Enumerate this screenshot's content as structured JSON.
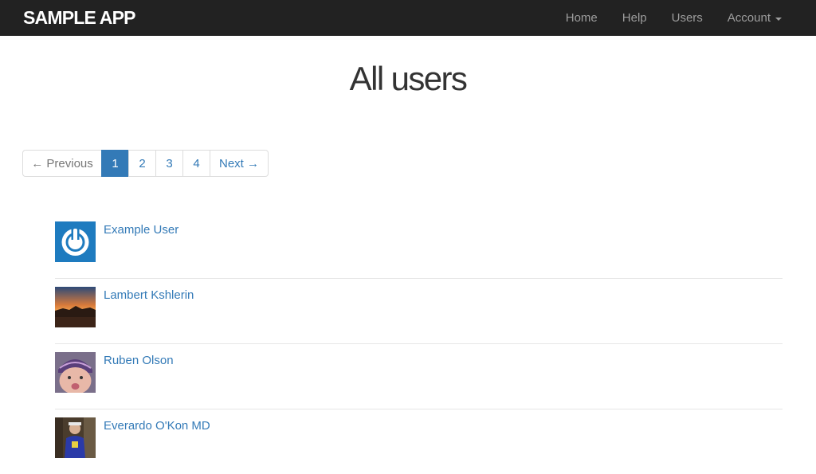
{
  "navbar": {
    "brand": "SAMPLE APP",
    "links": [
      "Home",
      "Help",
      "Users"
    ],
    "account_label": "Account",
    "account_icon": "caret-down-icon"
  },
  "page": {
    "title": "All users"
  },
  "pagination": {
    "previous_label": "← Previous",
    "pages": [
      "1",
      "2",
      "3",
      "4"
    ],
    "active_page": "1",
    "next_label": "Next →"
  },
  "users": [
    {
      "name": "Example User",
      "avatar": "power-icon-avatar"
    },
    {
      "name": "Lambert Kshlerin",
      "avatar": "sunset-photo-avatar"
    },
    {
      "name": "Ruben Olson",
      "avatar": "child-photo-avatar"
    },
    {
      "name": "Everardo O'Kon MD",
      "avatar": "person-photo-avatar"
    }
  ],
  "colors": {
    "navbar_bg": "#222222",
    "link": "#337ab7",
    "active_page_bg": "#337ab7"
  }
}
